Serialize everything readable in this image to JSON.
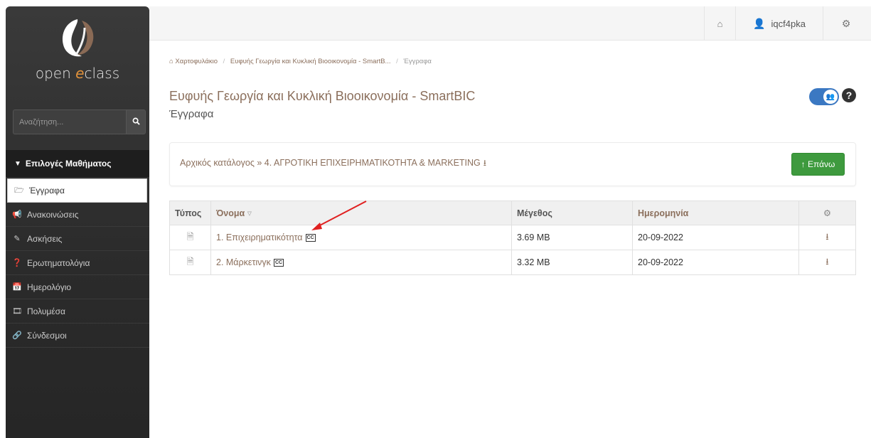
{
  "sidebar": {
    "logo_text_prefix": "open ",
    "logo_text_accent": "e",
    "logo_text_suffix": "class",
    "search_placeholder": "Αναζήτηση...",
    "course_menu_label": "Επιλογές Μαθήματος",
    "items": [
      {
        "label": "Έγγραφα",
        "icon": "folder-open-icon"
      },
      {
        "label": "Ανακοινώσεις",
        "icon": "bullhorn-icon"
      },
      {
        "label": "Ασκήσεις",
        "icon": "edit-icon"
      },
      {
        "label": "Ερωτηματολόγια",
        "icon": "question-circle-icon"
      },
      {
        "label": "Ημερολόγιο",
        "icon": "calendar-icon"
      },
      {
        "label": "Πολυμέσα",
        "icon": "film-icon"
      },
      {
        "label": "Σύνδεσμοι",
        "icon": "link-icon"
      }
    ]
  },
  "topbar": {
    "username": "iqcf4pka"
  },
  "breadcrumb": {
    "home": "Χαρτοφυλάκιο",
    "course": "Ευφυής Γεωργία και Κυκλική Βιοοικονομία - SmartB...",
    "current": "Έγγραφα"
  },
  "page": {
    "course_title": "Ευφυής Γεωργία και Κυκλική Βιοοικονομία - SmartBIC",
    "subtitle": "Έγγραφα"
  },
  "panel": {
    "path": "Αρχικός κατάλογος » 4. ΑΓΡΟΤΙΚΗ ΕΠΙΧΕΙΡΗΜΑΤΙΚΟΤΗΤΑ & MARKETING",
    "up_button": "Επάνω"
  },
  "table": {
    "headers": {
      "type": "Τύπος",
      "name": "Όνομα",
      "size": "Μέγεθος",
      "date": "Ημερομηνία"
    },
    "rows": [
      {
        "name": "1. Επιχειρηματικότητα",
        "badge": "CC",
        "size": "3.69 MB",
        "date": "20-09-2022"
      },
      {
        "name": "2. Μάρκετινγκ",
        "badge": "CC",
        "size": "3.32 MB",
        "date": "20-09-2022"
      }
    ]
  },
  "colors": {
    "accent_brown": "#8b6f5c",
    "sidebar_dark": "#2b2b2b",
    "button_green": "#3e9a3e",
    "toggle_blue": "#3b78c2",
    "annotation_red": "#e02020"
  }
}
